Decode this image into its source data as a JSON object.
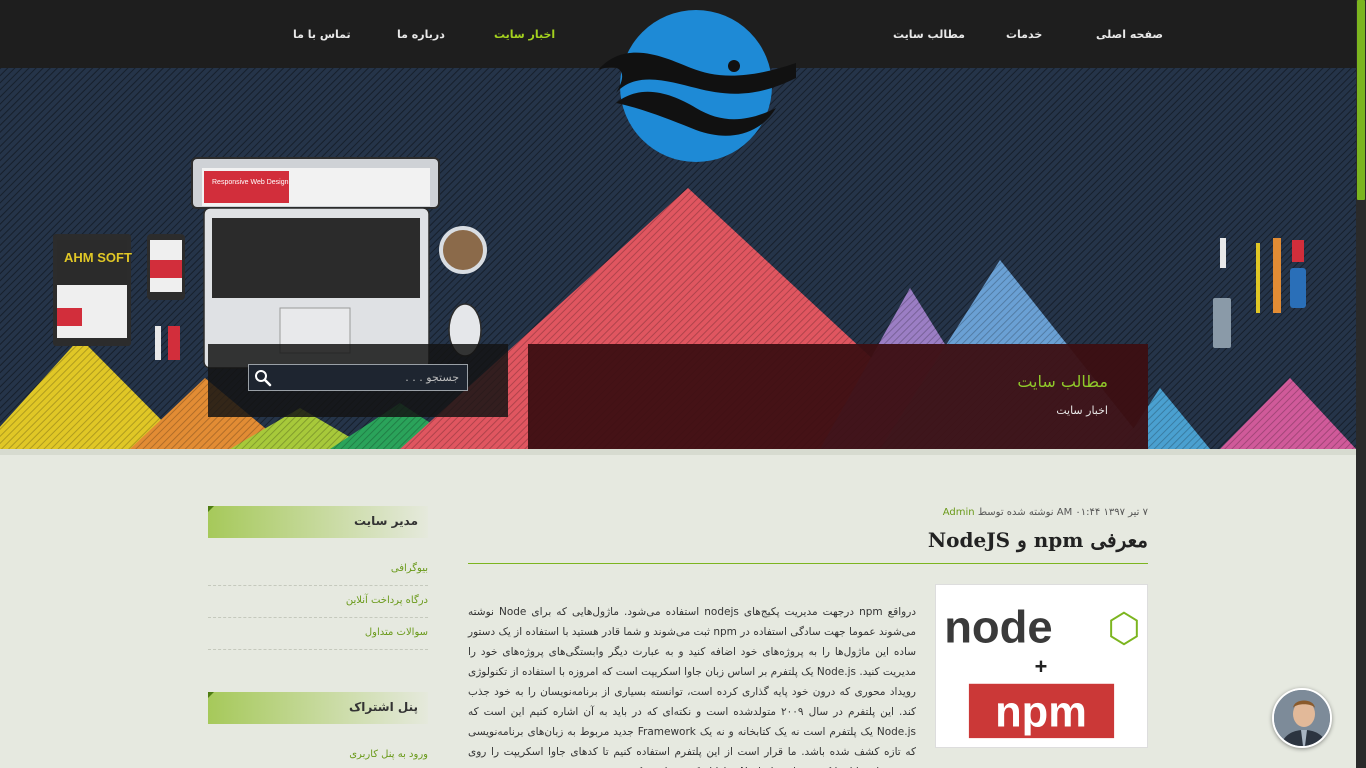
{
  "nav": {
    "items": [
      {
        "label": "صفحه اصلی",
        "active": false
      },
      {
        "label": "خدمات",
        "active": false
      },
      {
        "label": "مطالب سایت",
        "active": false
      },
      {
        "label": "اخبار سایت",
        "active": true
      },
      {
        "label": "درباره ما",
        "active": false
      },
      {
        "label": "تماس با ما",
        "active": false
      }
    ]
  },
  "hero": {
    "title": "مطالب سایت",
    "breadcrumb": "اخبار سایت",
    "device_text": "Responsive Web Design",
    "tablet_text": "AHM SOFT"
  },
  "search": {
    "placeholder": "جستجو . . ."
  },
  "sidebar": {
    "admin_title": "مدیر سایت",
    "admin_links": [
      "بیوگرافی",
      "درگاه پرداخت آنلاین",
      "سوالات متداول"
    ],
    "subscribe_title": "پنل اشتراک",
    "subscribe_links": [
      "ورود به پنل کاربری"
    ]
  },
  "post": {
    "meta_prefix": "۷ تیر ۱۳۹۷ ۰۱:۴۴ AM نوشته شده توسط",
    "author": "Admin",
    "title": "معرفی npm و NodeJS",
    "image_node": "node",
    "image_plus": "+",
    "image_npm": "npm",
    "body": "درواقع npm درجهت مدیریت پکیج‌های nodejs استفاده می‌شود. ماژول‌هایی که برای Node نوشته می‌شوند عموما جهت سادگی استفاده در npm ثبت می‌شوند و شما قادر هستید با استفاده از یک دستور ساده این ماژول‌ها را به پروژه‌های خود اضافه کنید و به عبارت دیگر وابستگی‌های پروژه‌های خود را مدیریت کنید. Node.js یک پلتفرم بر اساس زبان جاوا اسکریپت است که امروزه با استفاده از تکنولوژی رویداد محوری که درون خود پایه گذاری کرده است، توانسته بسیاری از برنامه‌نویسان را به خود جذب کند. این پلتفرم در سال ۲۰۰۹ متولدشده است و نکته‌ای که در باید به آن اشاره کنیم این است که Node.js یک پلتفرم است نه یک کتابخانه و نه یک Framework جدید مربوط به زبان‌های برنامه‌نویسی که تازه کشف شده باشد. ما قرار است از این پلتفرم استفاده کنیم تا کدهای جاوا اسکریپت را روی سرور برای ما اجرا کند. درواقع Node.js، جاوا اسکریپتی است که سمت"
  },
  "colors": {
    "accent": "#8fc92a",
    "nav_bg": "#1e1e1e",
    "hero_bg": "#253449",
    "content_bg": "#e6e9e0"
  }
}
